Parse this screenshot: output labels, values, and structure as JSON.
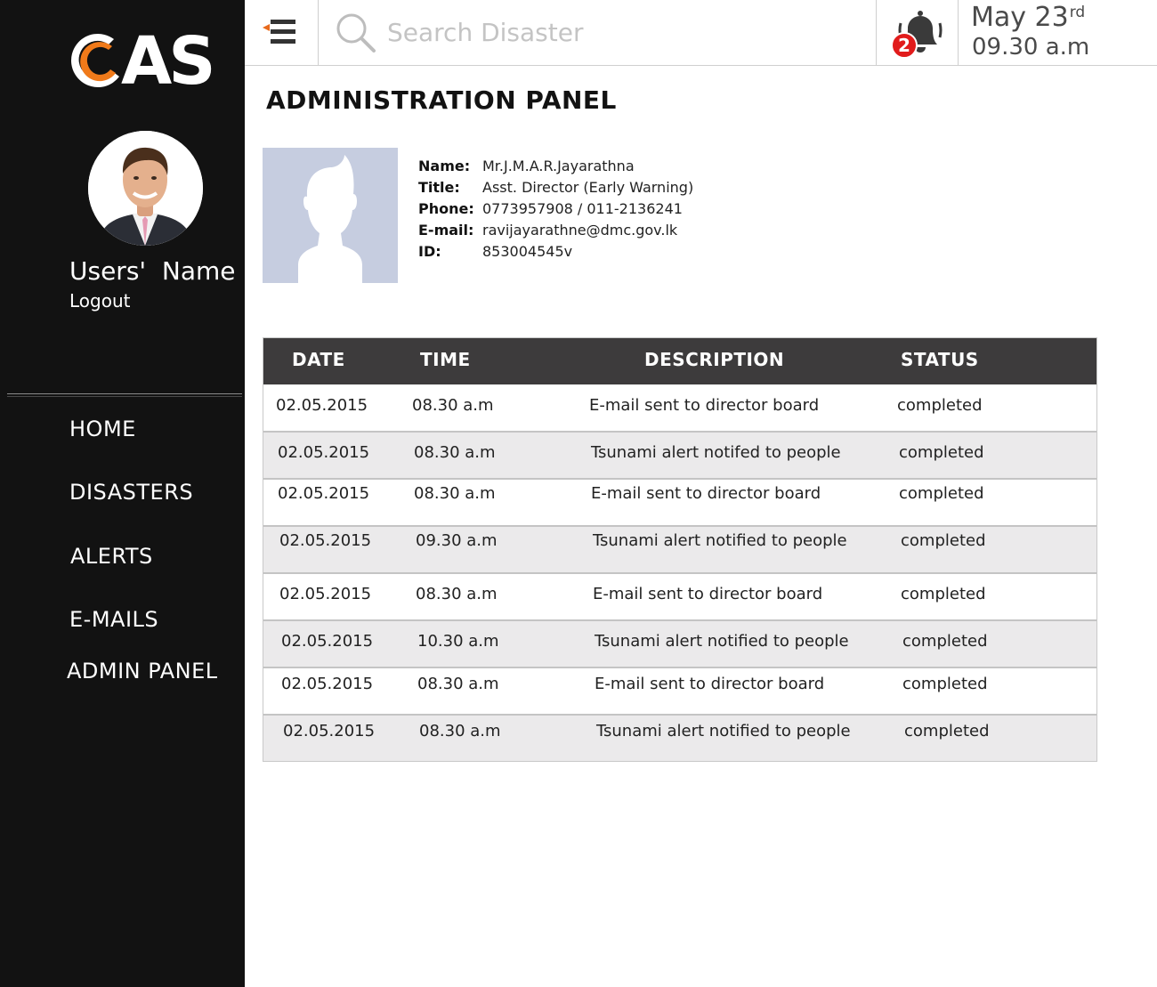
{
  "app": {
    "logo_text": "AS",
    "brand_color": "#f07a1a"
  },
  "user": {
    "name": "Users'  Name",
    "logout_label": "Logout"
  },
  "nav": [
    {
      "label": "HOME"
    },
    {
      "label": "DISASTERS"
    },
    {
      "label": "ALERTS"
    },
    {
      "label": "E-MAILS"
    },
    {
      "label": "ADMIN PANEL"
    }
  ],
  "topbar": {
    "menu_icon": "hamburger-collapse-icon",
    "search_placeholder": "Search Disaster",
    "search_icon": "search-icon",
    "bell_icon": "bell-icon",
    "notification_count": "2",
    "date": "May 23",
    "date_suffix": "rd",
    "time": "09.30 a.m"
  },
  "page": {
    "title": "ADMINISTRATION PANEL"
  },
  "profile": {
    "fields": [
      {
        "label": "Name:",
        "value": "Mr.J.M.A.R.Jayarathna"
      },
      {
        "label": "Title:",
        "value": "Asst. Director (Early Warning)"
      },
      {
        "label": "Phone:",
        "value": "0773957908 / 011-2136241"
      },
      {
        "label": "E-mail:",
        "value": "ravijayarathne@dmc.gov.lk"
      },
      {
        "label": "ID:",
        "value": "853004545v"
      }
    ]
  },
  "table": {
    "headers": [
      "DATE",
      "TIME",
      "DESCRIPTION",
      "STATUS"
    ],
    "rows": [
      {
        "date": "02.05.2015",
        "time": "08.30 a.m",
        "description": "E-mail sent to director board",
        "status": "completed"
      },
      {
        "date": "02.05.2015",
        "time": "08.30 a.m",
        "description": "Tsunami alert notifed to people",
        "status": "completed"
      },
      {
        "date": "02.05.2015",
        "time": "08.30 a.m",
        "description": "E-mail sent to director board",
        "status": "completed"
      },
      {
        "date": "02.05.2015",
        "time": "09.30 a.m",
        "description": "Tsunami alert notified to people",
        "status": "completed"
      },
      {
        "date": "02.05.2015",
        "time": "08.30 a.m",
        "description": "E-mail sent to director board",
        "status": "completed"
      },
      {
        "date": "02.05.2015",
        "time": "10.30 a.m",
        "description": "Tsunami alert notified to people",
        "status": "completed"
      },
      {
        "date": "02.05.2015",
        "time": "08.30 a.m",
        "description": "E-mail sent to director board",
        "status": "completed"
      },
      {
        "date": "02.05.2015",
        "time": "08.30 a.m",
        "description": "Tsunami alert notified to people",
        "status": "completed"
      }
    ]
  }
}
